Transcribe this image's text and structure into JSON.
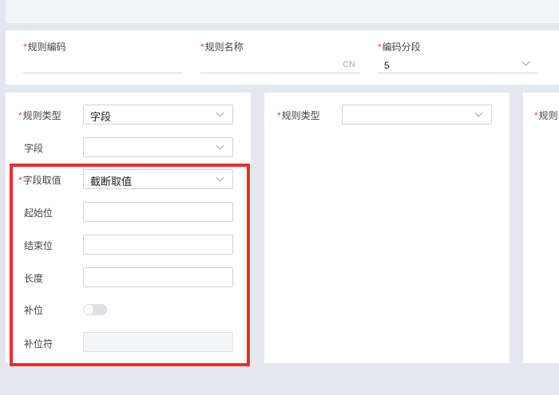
{
  "header": {
    "rule_code": {
      "label": "规则编码",
      "value": ""
    },
    "rule_name": {
      "label": "规则名称",
      "value": "",
      "suffix": "CN"
    },
    "code_segment": {
      "label": "编码分段",
      "value": "5"
    }
  },
  "card1": {
    "rule_type": {
      "label": "规则类型",
      "value": "字段"
    },
    "field": {
      "label": "字段",
      "value": ""
    },
    "field_value": {
      "label": "字段取值",
      "value": "截断取值"
    },
    "start_pos": {
      "label": "起始位",
      "value": ""
    },
    "end_pos": {
      "label": "结束位",
      "value": ""
    },
    "length": {
      "label": "长度",
      "value": ""
    },
    "pad": {
      "label": "补位",
      "on": false
    },
    "pad_char": {
      "label": "补位符",
      "value": ""
    }
  },
  "card2": {
    "rule_type": {
      "label": "规则类型",
      "value": ""
    }
  },
  "card3": {
    "rule_type": {
      "label": "规则",
      "value": ""
    }
  },
  "required_mark": "*",
  "colors": {
    "highlight": "#ee2b2b",
    "required": "#f04040"
  }
}
